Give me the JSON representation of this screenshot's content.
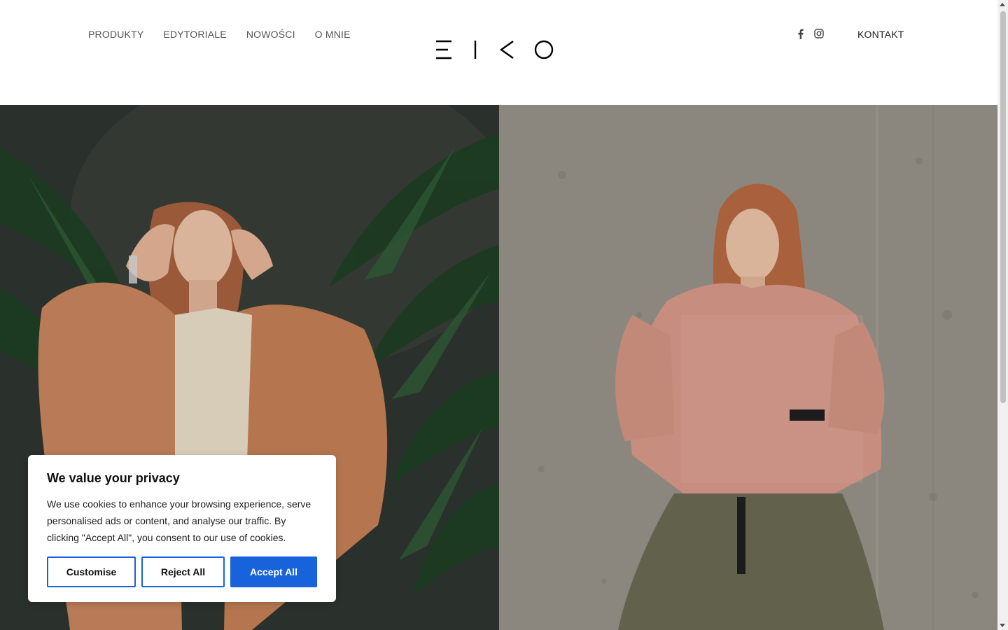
{
  "nav": {
    "items": [
      {
        "label": "PRODUKTY"
      },
      {
        "label": "EDYTORIALE"
      },
      {
        "label": "NOWOŚCI"
      },
      {
        "label": "O MNIE"
      }
    ]
  },
  "logo": {
    "alt": "EIKO"
  },
  "social": {
    "icons": [
      "facebook-icon",
      "instagram-icon"
    ]
  },
  "header": {
    "contact_label": "KONTAKT"
  },
  "cookie_banner": {
    "title": "We value your privacy",
    "body": "We use cookies to enhance your browsing experience, serve personalised ads or content, and analyse our traffic. By clicking \"Accept All\", you consent to our use of cookies.",
    "customise_label": "Customise",
    "reject_label": "Reject All",
    "accept_label": "Accept All"
  },
  "colors": {
    "accent": "#1863dc",
    "nav_text": "#555555"
  }
}
